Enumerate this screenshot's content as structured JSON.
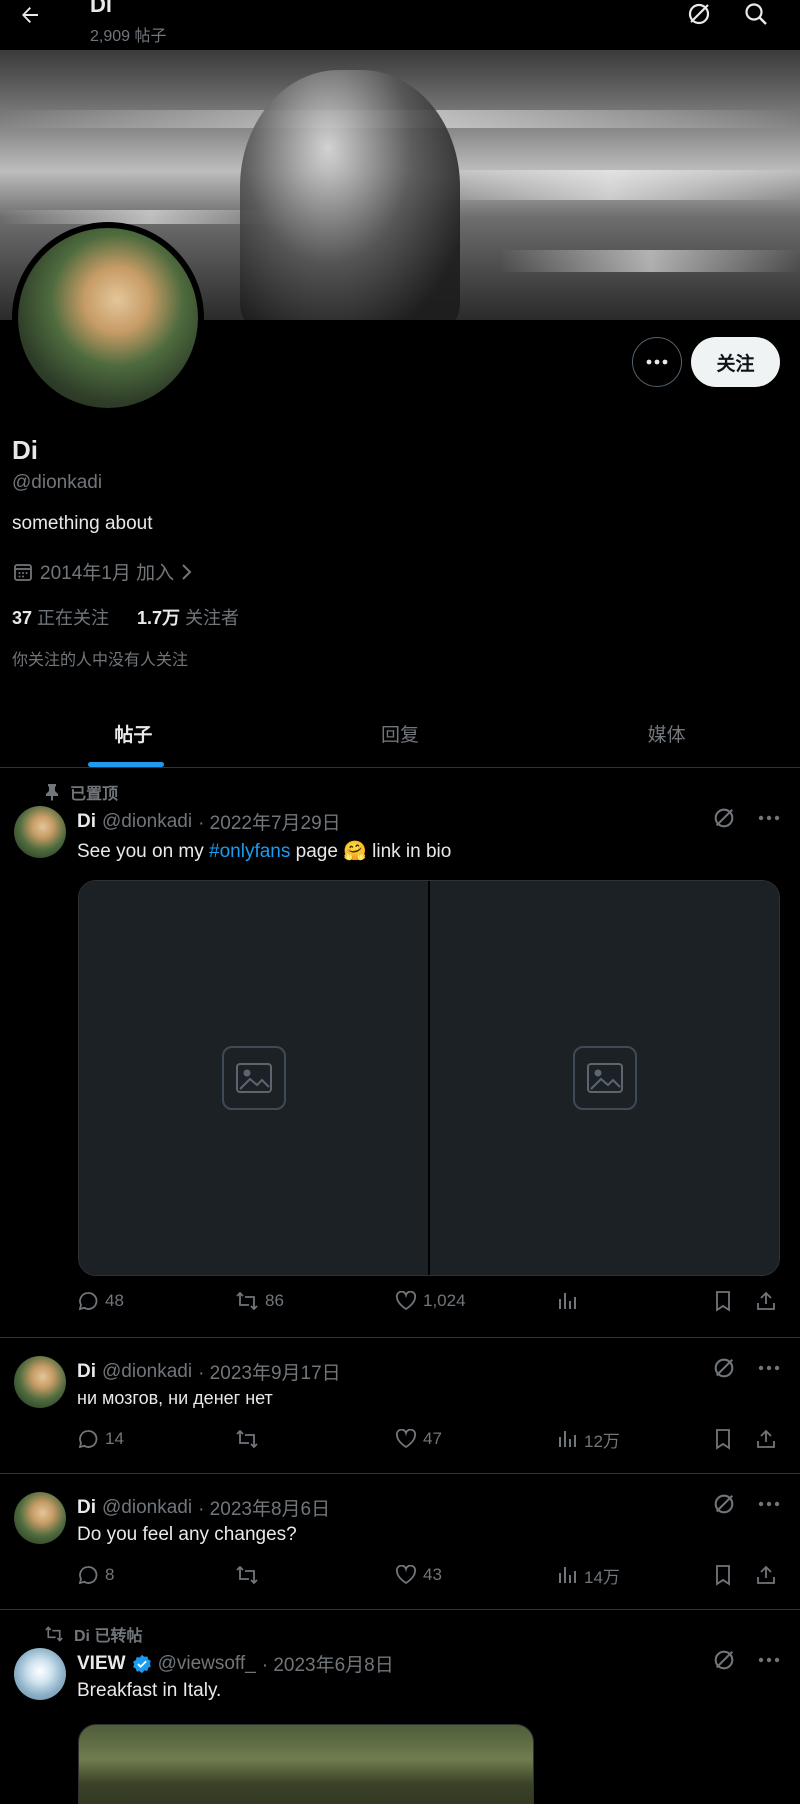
{
  "header": {
    "title": "Di",
    "post_count": "2,909 帖子",
    "icons": [
      "back-arrow-icon",
      "grok-icon",
      "search-icon"
    ]
  },
  "profile": {
    "name": "Di",
    "handle": "@dionkadi",
    "bio": "something about",
    "joined": "2014年1月 加入",
    "following_count": "37",
    "following_label": "正在关注",
    "followers_count": "1.7万",
    "followers_label": "关注者",
    "followed_by_note": "你关注的人中没有人关注",
    "follow_button": "关注",
    "more_icon": "more-icon"
  },
  "tabs": [
    {
      "label": "帖子",
      "active": true
    },
    {
      "label": "回复",
      "active": false
    },
    {
      "label": "媒体",
      "active": false
    }
  ],
  "posts": [
    {
      "context": "已置顶",
      "name": "Di",
      "handle": "@dionkadi",
      "date": "· 2022年7月29日",
      "text_before": "See you on my ",
      "hashtag": "#onlyfans",
      "text_after": " page 🤗 link in bio",
      "replies": "48",
      "reposts": "86",
      "likes": "1,024",
      "views": ""
    },
    {
      "name": "Di",
      "handle": "@dionkadi",
      "date": "· 2023年9月17日",
      "text": "ни мозгов, ни денег нет",
      "replies": "14",
      "reposts": "",
      "likes": "47",
      "views": "12万"
    },
    {
      "name": "Di",
      "handle": "@dionkadi",
      "date": "· 2023年8月6日",
      "text": "Do you feel any changes?",
      "replies": "8",
      "reposts": "",
      "likes": "43",
      "views": "14万"
    },
    {
      "context": "Di 已转帖",
      "name": "VIEW",
      "handle": "@viewsoff_",
      "date": "· 2023年6月8日",
      "text": "Breakfast in Italy."
    }
  ],
  "colors": {
    "background": "#000000",
    "text": "#e7e9ea",
    "muted": "#71767b",
    "accent": "#1d9bf0",
    "border": "#2f3336"
  }
}
